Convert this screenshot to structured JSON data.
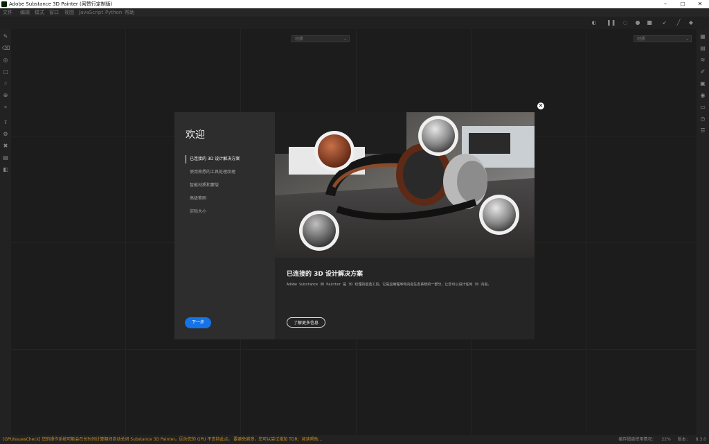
{
  "window": {
    "title": "Adobe Substance 3D Painter (网赞行定制版)"
  },
  "menubar": {
    "items": [
      "文件",
      "编辑",
      "模式",
      "窗口",
      "视图",
      "JavaScript",
      "Python",
      "帮助"
    ]
  },
  "viewport": {
    "left_dropdown": "材质",
    "right_dropdown": "材质"
  },
  "dialog": {
    "welcome": "欢迎",
    "nav": [
      "已连接的 3D 设计解决方案",
      "使用熟悉的工具处理纹理",
      "智能材质和蒙版",
      "高级笔刷",
      "实际大小"
    ],
    "next_label": "下一步",
    "content_title": "已连接的 3D 设计解决方案",
    "content_desc": "Adobe Substance 3D Painter 是 3D 纹理的首选工具，它是应用程序和内容生态系统的一部分，让您可以设计任何 3D 内容。",
    "learn_more_label": "了解更多信息"
  },
  "status": {
    "warning": "[GPUIssuesCheck] 您的操作系统可能会在长时间计算期间自动关闭 Substance 3D Painter。因为您的 GPU 不支持此点。 要避免崩溃，您可以尝试增加 TDR：阅读帮助...",
    "cache_label": "缓存磁盘使用情况：",
    "cache_value": "22%",
    "version_label": "版本：",
    "version_value": "8.3.0"
  }
}
